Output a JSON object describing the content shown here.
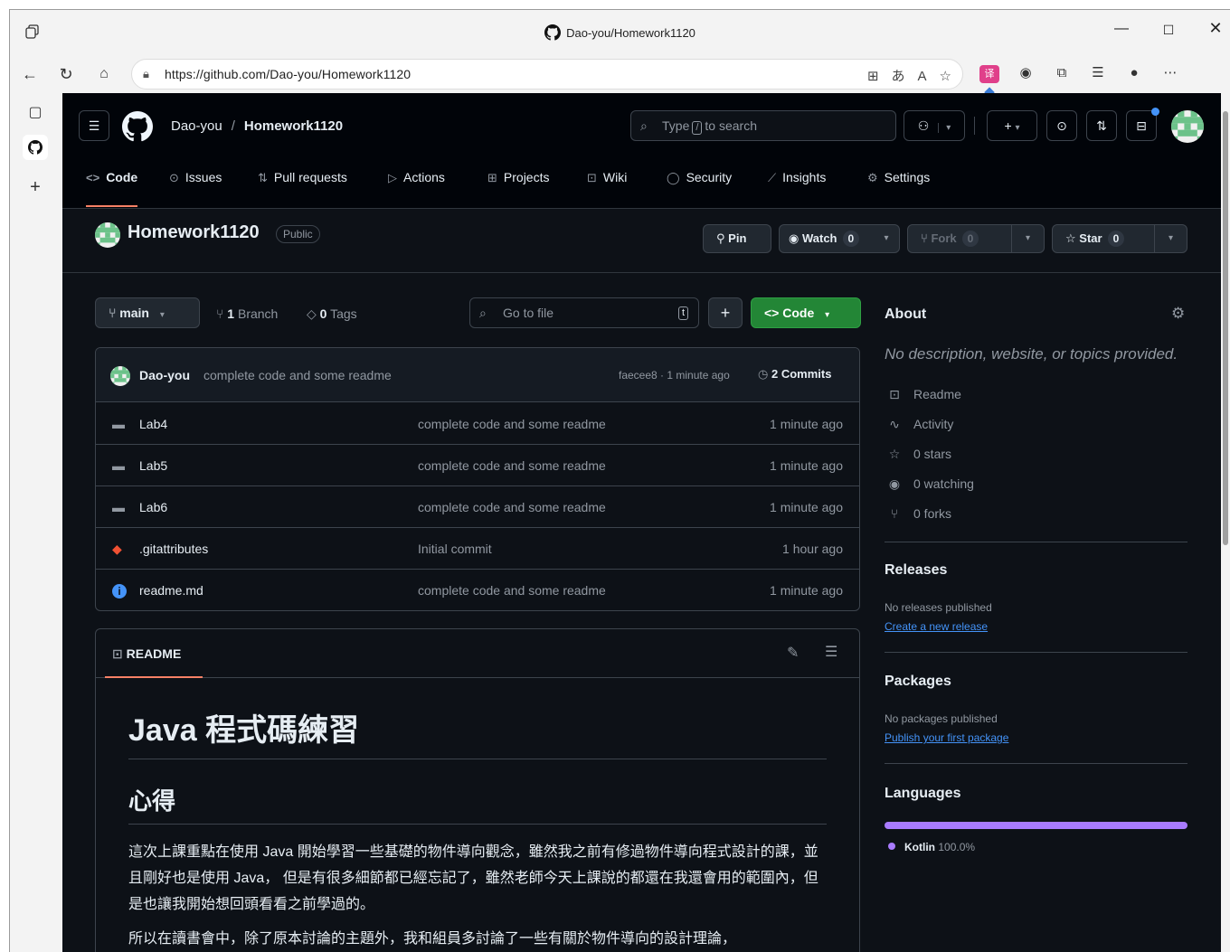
{
  "browser": {
    "window_title": "Dao-you/Homework1120",
    "url": "https://github.com/Dao-you/Homework1120"
  },
  "header": {
    "owner": "Dao-you",
    "separator": "/",
    "repo": "Homework1120",
    "search_pre": "Type",
    "search_key": "/",
    "search_post": "to search"
  },
  "tabs": [
    {
      "label": "Code",
      "icon": "code-icon",
      "active": true
    },
    {
      "label": "Issues",
      "icon": "issue-icon"
    },
    {
      "label": "Pull requests",
      "icon": "pull-request-icon"
    },
    {
      "label": "Actions",
      "icon": "play-icon"
    },
    {
      "label": "Projects",
      "icon": "table-icon"
    },
    {
      "label": "Wiki",
      "icon": "book-icon"
    },
    {
      "label": "Security",
      "icon": "shield-icon"
    },
    {
      "label": "Insights",
      "icon": "graph-icon"
    },
    {
      "label": "Settings",
      "icon": "gear-icon"
    }
  ],
  "repo": {
    "name": "Homework1120",
    "visibility": "Public",
    "pin_label": "Pin",
    "watch_label": "Watch",
    "watch_count": "0",
    "fork_label": "Fork",
    "fork_count": "0",
    "star_label": "Star",
    "star_count": "0"
  },
  "toolbar": {
    "branch": "main",
    "branch_count": "1",
    "branch_label": "Branch",
    "tag_count": "0",
    "tag_label": "Tags",
    "goto_placeholder": "Go to file",
    "goto_key": "t",
    "code_label": "Code"
  },
  "commit": {
    "author": "Dao-you",
    "message": "complete code and some readme",
    "meta": "faecee8 · 1 minute ago",
    "commits_count": "2",
    "commits_label": "Commits"
  },
  "files": [
    {
      "name": "Lab4",
      "type": "folder",
      "message": "complete code and some readme",
      "time": "1 minute ago"
    },
    {
      "name": "Lab5",
      "type": "folder",
      "message": "complete code and some readme",
      "time": "1 minute ago"
    },
    {
      "name": "Lab6",
      "type": "folder",
      "message": "complete code and some readme",
      "time": "1 minute ago"
    },
    {
      "name": ".gitattributes",
      "type": "git",
      "message": "Initial commit",
      "time": "1 hour ago"
    },
    {
      "name": "readme.md",
      "type": "info",
      "message": "complete code and some readme",
      "time": "1 minute ago"
    }
  ],
  "readme": {
    "tab_label": "README",
    "h1": "Java 程式碼練習",
    "h2": "心得",
    "p1": "這次上課重點在使用 Java 開始學習一些基礎的物件導向觀念，雖然我之前有修過物件導向程式設計的課，並且剛好也是使用 Java， 但是有很多細節都已經忘記了，雖然老師今天上課說的都還在我還會用的範圍內，但是也讓我開始想回頭看看之前學過的。",
    "p2": "所以在讀書會中，除了原本討論的主題外，我和組員多討論了一些有關於物件導向的設計理論，"
  },
  "about": {
    "title": "About",
    "description": "No description, website, or topics provided.",
    "items": [
      {
        "icon": "book-icon",
        "label": "Readme"
      },
      {
        "icon": "pulse-icon",
        "label": "Activity"
      },
      {
        "icon": "star-icon",
        "label": "0 stars"
      },
      {
        "icon": "eye-icon",
        "label": "0 watching"
      },
      {
        "icon": "fork-icon",
        "label": "0 forks"
      }
    ],
    "releases_title": "Releases",
    "releases_text": "No releases published",
    "releases_link": "Create a new release",
    "packages_title": "Packages",
    "packages_text": "No packages published",
    "packages_link": "Publish your first package",
    "languages_title": "Languages",
    "language_name": "Kotlin",
    "language_pct": "100.0%",
    "language_color": "#A97BFF",
    "language_share": 1.0
  },
  "colors": {
    "bg": "#0d1117",
    "header_bg": "#010409",
    "green_button": "#238636",
    "accent_underline": "#f78166",
    "link": "#4493f8"
  }
}
